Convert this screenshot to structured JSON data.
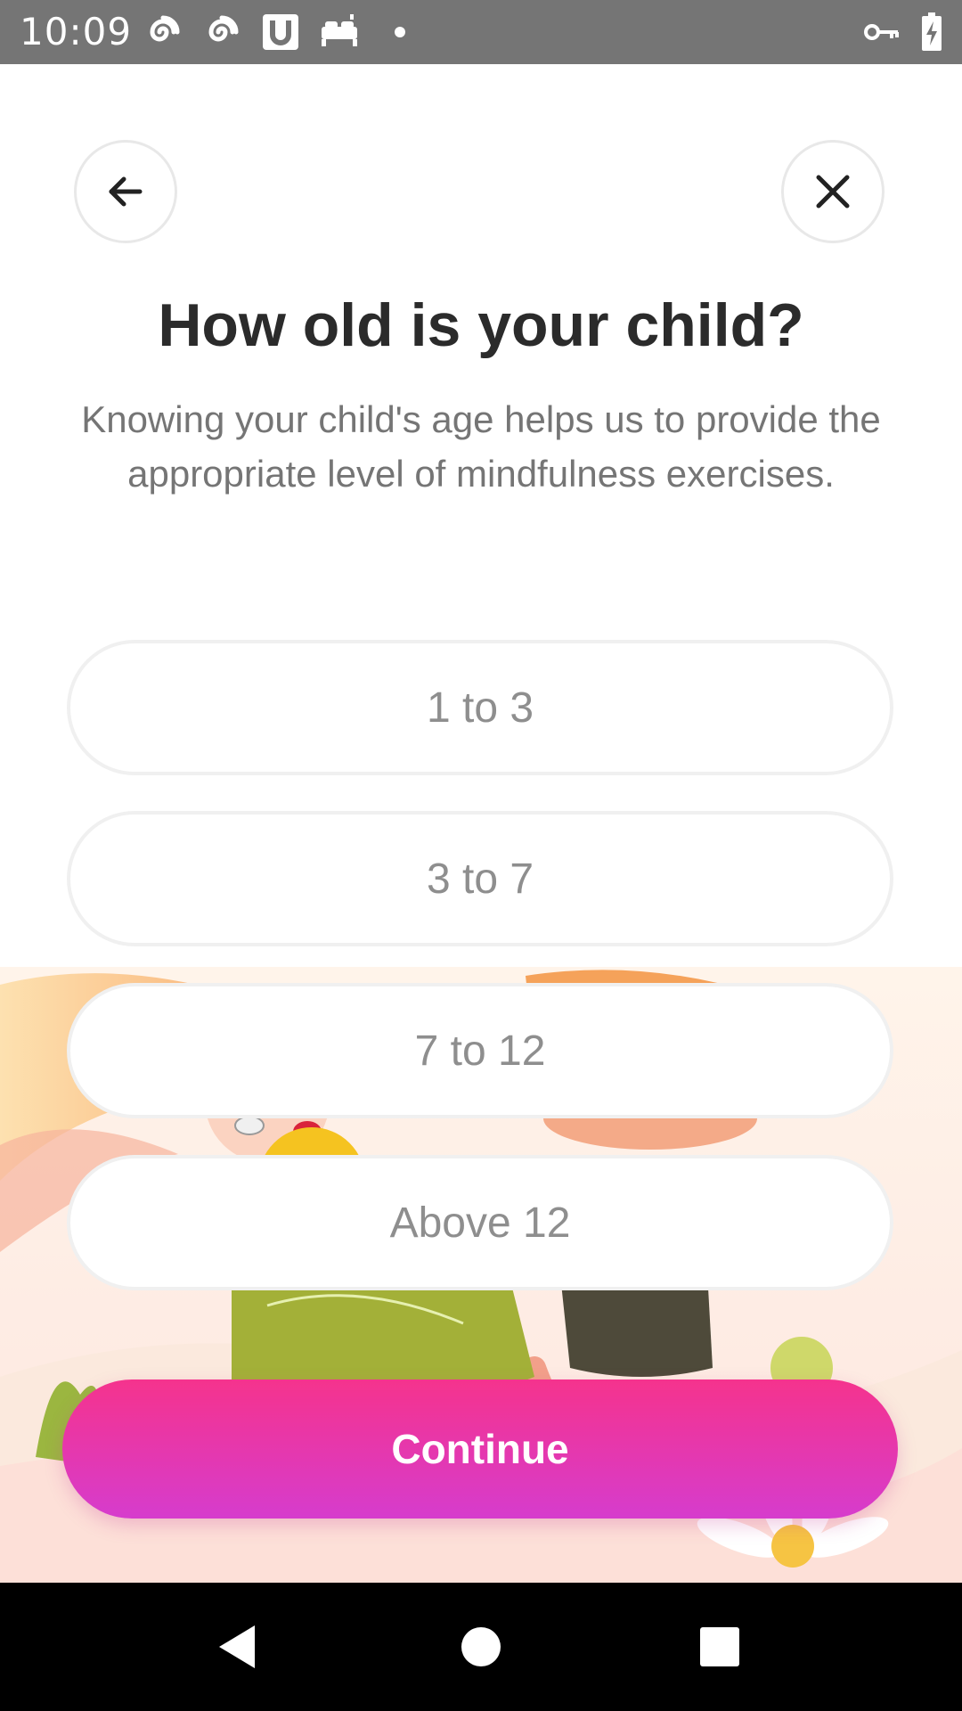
{
  "status_bar": {
    "time": "10:09",
    "icons": [
      "spiral-icon",
      "spiral-icon",
      "u-box-icon",
      "bed-icon",
      "dot-icon",
      "key-icon",
      "battery-charging-icon"
    ]
  },
  "header": {
    "back_icon": "arrow-left-icon",
    "close_icon": "close-icon"
  },
  "main": {
    "title": "How old is your child?",
    "subtitle": "Knowing your child's age helps us to provide the appropriate level of mindfulness exercises.",
    "options": [
      {
        "label": "1 to 3"
      },
      {
        "label": "3 to 7"
      },
      {
        "label": "7 to 12"
      },
      {
        "label": "Above 12"
      }
    ],
    "continue_label": "Continue"
  },
  "nav_bar": {
    "icons": [
      "back-triangle-icon",
      "home-circle-icon",
      "recents-square-icon"
    ]
  },
  "colors": {
    "accent_start": "#f5338d",
    "accent_end": "#d63ccd",
    "title_text": "#2b2b2b",
    "muted_text": "#757575"
  }
}
